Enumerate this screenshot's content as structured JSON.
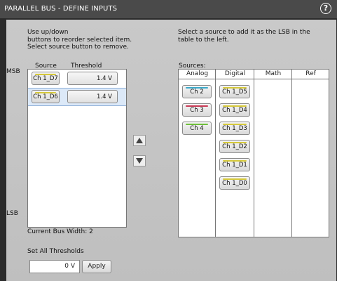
{
  "window": {
    "title": "PARALLEL BUS - DEFINE INPUTS",
    "help_glyph": "?"
  },
  "left": {
    "instructions": [
      "Use up/down",
      "buttons to reorder selected item.",
      "Select source button to remove."
    ],
    "headers": {
      "source": "Source",
      "threshold": "Threshold"
    },
    "msb_label": "MSB",
    "lsb_label": "LSB",
    "rows": [
      {
        "source": "Ch 1_D7",
        "threshold": "1.4 V",
        "selected": false,
        "color": "#d6c93a"
      },
      {
        "source": "Ch 1_D6",
        "threshold": "1.4 V",
        "selected": true,
        "color": "#d6c93a"
      }
    ],
    "bus_width_label": "Current Bus Width: 2",
    "set_all_label": "Set All Thresholds",
    "set_all_value": "0 V",
    "apply_label": "Apply"
  },
  "right": {
    "instructions": [
      "Select a source to add it as the LSB in the",
      "table to the left."
    ],
    "sources_label": "Sources:",
    "columns": [
      "Analog",
      "Digital",
      "Math",
      "Ref"
    ],
    "analog": [
      {
        "label": "Ch 2",
        "color": "#3aa8c9"
      },
      {
        "label": "Ch 3",
        "color": "#c93a56"
      },
      {
        "label": "Ch 4",
        "color": "#6fbf3a"
      }
    ],
    "digital": [
      {
        "label": "Ch 1_D5",
        "color": "#d6c93a"
      },
      {
        "label": "Ch 1_D4",
        "color": "#d6c93a"
      },
      {
        "label": "Ch 1_D3",
        "color": "#d6c93a"
      },
      {
        "label": "Ch 1_D2",
        "color": "#d6c93a"
      },
      {
        "label": "Ch 1_D1",
        "color": "#d6c93a"
      },
      {
        "label": "Ch 1_D0",
        "color": "#d6c93a"
      }
    ]
  },
  "icons": {
    "up": "triangle-up-icon",
    "down": "triangle-down-icon"
  }
}
